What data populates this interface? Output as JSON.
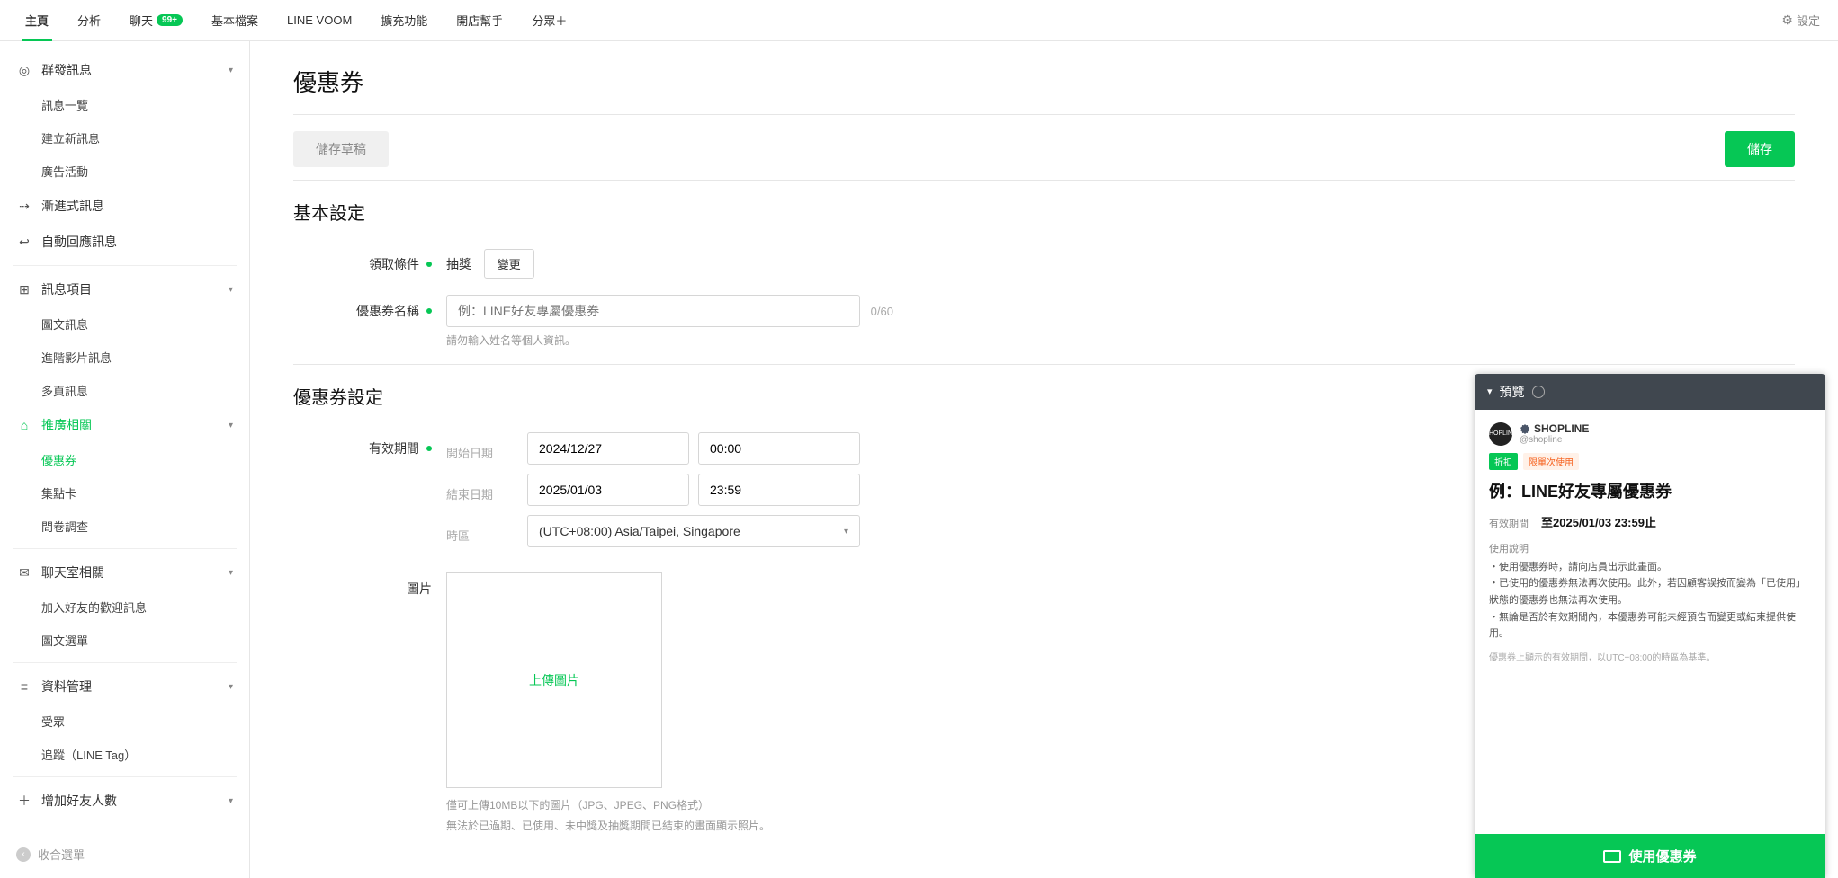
{
  "topnav": {
    "tabs": [
      "主頁",
      "分析",
      "聊天",
      "基本檔案",
      "LINE VOOM",
      "擴充功能",
      "開店幫手",
      "分眾＋"
    ],
    "chat_badge": "99+",
    "settings": "設定"
  },
  "sidebar": {
    "broadcast": {
      "title": "群發訊息",
      "items": [
        "訊息一覽",
        "建立新訊息",
        "廣告活動"
      ]
    },
    "progressive": "漸進式訊息",
    "auto_reply": "自動回應訊息",
    "msg_items": {
      "title": "訊息項目",
      "items": [
        "圖文訊息",
        "進階影片訊息",
        "多頁訊息"
      ]
    },
    "promo": {
      "title": "推廣相關",
      "items": [
        "優惠券",
        "集點卡",
        "問卷調查"
      ]
    },
    "chatroom": {
      "title": "聊天室相關",
      "items": [
        "加入好友的歡迎訊息",
        "圖文選單"
      ]
    },
    "data": {
      "title": "資料管理",
      "items": [
        "受眾",
        "追蹤（LINE Tag）"
      ]
    },
    "gain": "增加好友人數",
    "collapse": "收合選單"
  },
  "page": {
    "title": "優惠券",
    "save_draft": "儲存草稿",
    "save": "儲存"
  },
  "basic": {
    "title": "基本設定",
    "claim_label": "領取條件",
    "claim_value": "抽獎",
    "change_btn": "變更",
    "name_label": "優惠券名稱",
    "name_placeholder": "例：LINE好友專屬優惠券",
    "counter": "0/60",
    "name_hint": "請勿輸入姓名等個人資訊。"
  },
  "settings": {
    "title": "優惠券設定",
    "valid_label": "有效期間",
    "start_label": "開始日期",
    "start_date": "2024/12/27",
    "start_time": "00:00",
    "end_label": "結束日期",
    "end_date": "2025/01/03",
    "end_time": "23:59",
    "tz_label": "時區",
    "tz_value": "(UTC+08:00) Asia/Taipei, Singapore",
    "image_label": "圖片",
    "upload": "上傳圖片",
    "image_hint1": "僅可上傳10MB以下的圖片（JPG、JPEG、PNG格式）",
    "image_hint2": "無法於已過期、已使用、未中獎及抽獎期間已結束的畫面顯示照片。"
  },
  "preview": {
    "title": "預覽",
    "account": "SHOPLINE",
    "handle": "@shopline",
    "badge_discount": "折扣",
    "badge_limit": "限單次使用",
    "coupon_title": "例：LINE好友專屬優惠券",
    "valid_k": "有效期間",
    "valid_v": "至2025/01/03 23:59止",
    "desc_label": "使用說明",
    "desc_1": "・使用優惠券時，請向店員出示此畫面。",
    "desc_2": "・已使用的優惠券無法再次使用。此外，若因顧客誤按而變為「已使用」狀態的優惠券也無法再次使用。",
    "desc_3": "・無論是否於有效期間內，本優惠券可能未經預告而變更或結束提供使用。",
    "note": "優惠券上顯示的有效期間，以UTC+08:00的時區為基準。",
    "cta": "使用優惠券"
  }
}
